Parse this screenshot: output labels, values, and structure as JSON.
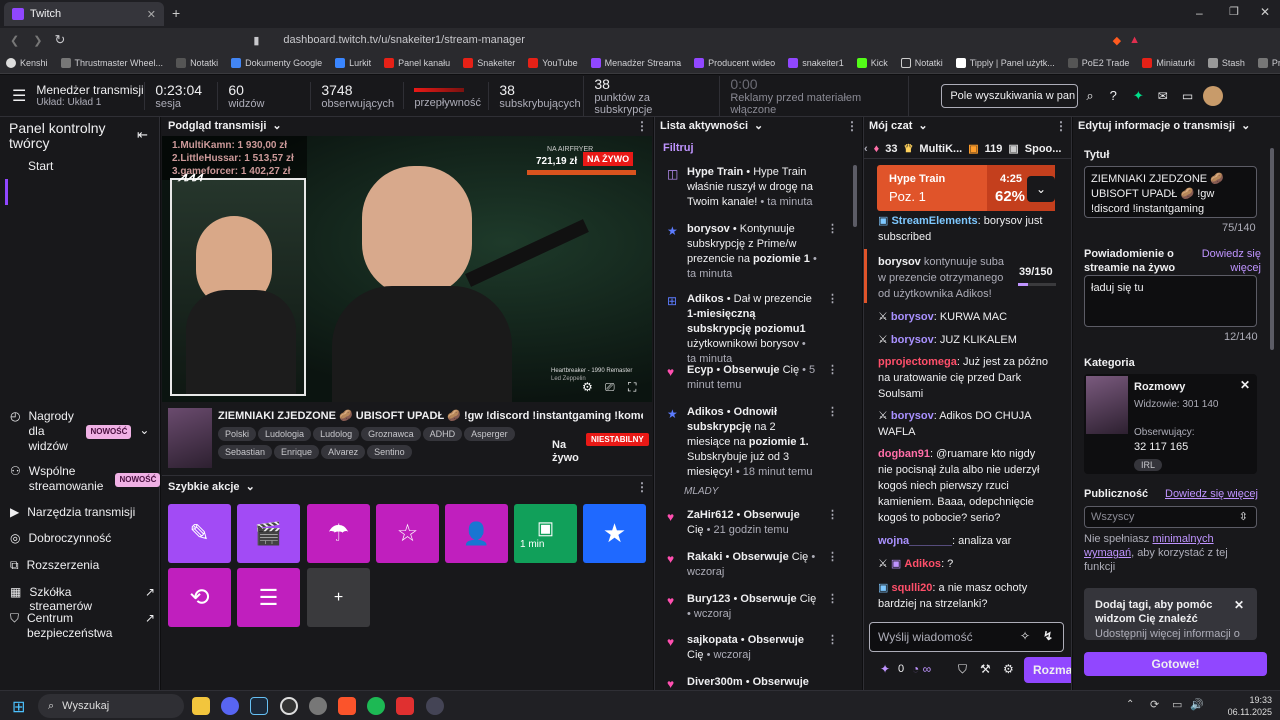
{
  "browser": {
    "tab_title": "Twitch",
    "url": "dashboard.twitch.tv/u/snakeiter1/stream-manager",
    "bookmarks": [
      "Kenshi",
      "Thrustmaster Wheel...",
      "Notatki",
      "Dokumenty Google",
      "Lurkit",
      "Panel kanału",
      "Snakeiter",
      "YouTube",
      "Menadżer Streama",
      "Producent wideo",
      "snakeiter1",
      "Kick",
      "Notatki",
      "Tipply | Panel użytk...",
      "PoE2 Trade",
      "Miniaturki",
      "Stash",
      "Przeczytaj - Kurs log..."
    ]
  },
  "header": {
    "title": "Menedżer transmisji",
    "layout": "Układ: Układ 1",
    "stats": [
      {
        "value": "0:23:04",
        "label": "sesja"
      },
      {
        "value": "60",
        "label": "widzów"
      },
      {
        "value": "3748",
        "label": "obserwujących"
      },
      {
        "value": "",
        "label": "przepływność"
      },
      {
        "value": "38",
        "label": "subskrybujących"
      },
      {
        "value": "38",
        "label": "punktów za subskrypcje"
      },
      {
        "value": "0:00",
        "label": "Reklamy przed materiałem włączone"
      }
    ],
    "search_placeholder": "Pole wyszukiwania w pan"
  },
  "leftnav": {
    "title": "Panel kontrolny twórcy",
    "items": [
      {
        "label": "Start"
      },
      {
        "label": "Nagrody dla widzów",
        "badge": "NOWOŚĆ"
      },
      {
        "label": "Wspólne streamowanie",
        "badge": "NOWOŚĆ"
      },
      {
        "label": "Narzędzia transmisji"
      },
      {
        "label": "Dobroczynność"
      },
      {
        "label": "Rozszerzenia"
      },
      {
        "label": "Szkółka streamerów"
      },
      {
        "label": "Centrum bezpieczeństwa"
      }
    ]
  },
  "preview": {
    "title": "Podgląd transmisji",
    "leaderboard": [
      "1.MultiKamn: 1 930,00 zł",
      "2.LittleHussar: 1 513,57 zł",
      "3.gameforcer: 1 402,27 zł"
    ],
    "overlay_amount": "721,19 zł",
    "live_badge": "NA ŻYWO",
    "airfryer": "NA AIRFRYER",
    "song": "Heartbreaker - 1990 Remaster",
    "artist": "Led Zeppelin",
    "stream_title": "ZIEMNIAKI ZJEDZONE 🥔 UBISOFT UPADŁ 🥔 !gw !discord !instantgaming !komendy",
    "tags": [
      "Polski",
      "Ludologia",
      "Ludolog",
      "Groznawca",
      "ADHD",
      "Asperger",
      "Sebastian",
      "Enrique",
      "Alvarez",
      "Sentino"
    ],
    "status": "Na żywo",
    "unstable": "NIESTABILNY"
  },
  "quick_actions": {
    "title": "Szybkie akcje",
    "ad_label": "1 min",
    "add": "+"
  },
  "activity": {
    "title": "Lista aktywności",
    "filter": "Filtruj",
    "items": [
      {
        "user": "Hype Train",
        "text": " • Hype Train właśnie ruszył w drogę na Twoim kanale!",
        "time": " • ta minuta"
      },
      {
        "user": "borysov",
        "text": " • Kontynuuje subskrypcję z Prime/w prezencie na ",
        "bold2": "poziomie 1",
        "time": " • ta minuta"
      },
      {
        "user": "Adikos",
        "text": " • Dał w prezencie ",
        "bold2": "1-miesięczną subskrypcję poziomu1",
        "text2": " użytkownikowi borysov",
        "time": " • ta minuta"
      },
      {
        "user": "Ecyp",
        "text": " • ",
        "bold2": "Obserwuje",
        "text2": " Cię",
        "time": " • 5 minut temu"
      },
      {
        "user": "Adikos",
        "text": " • ",
        "bold2": "Odnowił subskrypcję",
        "text2": " na 2 miesiące na ",
        "bold3": "poziomie 1.",
        "text3": " Subskrybuje już od 3 miesięcy!",
        "time": " • 18 minut temu",
        "msg": "MLADY"
      },
      {
        "user": "ZaHir612",
        "text": " • ",
        "bold2": "Obserwuje",
        "text2": " Cię",
        "time": " • 21 godzin temu"
      },
      {
        "user": "Rakaki",
        "text": " • ",
        "bold2": "Obserwuje",
        "text2": " Cię",
        "time": " • wczoraj"
      },
      {
        "user": "Bury123",
        "text": " • ",
        "bold2": "Obserwuje",
        "text2": " Cię",
        "time": " • wczoraj"
      },
      {
        "user": "sajkopata",
        "text": " • ",
        "bold2": "Obserwuje",
        "text2": " Cię",
        "time": " • wczoraj"
      },
      {
        "user": "Diver300m",
        "text": " • ",
        "bold2": "Obserwuje",
        "text2": "",
        "time": ""
      }
    ]
  },
  "chat": {
    "title": "Mój czat",
    "top_bar": [
      "33",
      "MultiK...",
      "119",
      "Spoo..."
    ],
    "hype_train": {
      "label": "Hype Train",
      "level": "Poz. 1",
      "timer": "4:25",
      "percent": "62%"
    },
    "sub_progress": "39/150",
    "messages": [
      {
        "user": "StreamElements",
        "user_color": "#7ec8ff",
        "text": ": borysov just subscribed"
      },
      {
        "user": "borysov",
        "user_color": "#efeff1",
        "text": " kontynuuje suba w prezencie otrzymanego od użytkownika Adikos!"
      },
      {
        "user": "borysov",
        "user_color": "#a991ff",
        "text": ": KURWA MAC"
      },
      {
        "user": "borysov",
        "user_color": "#a991ff",
        "text": ": JUZ KLIKALEM"
      },
      {
        "user": "pprojectomega",
        "user_color": "#ff4f6a",
        "text": ": Już jest za późno na uratowanie cię przed Dark Soulsami"
      },
      {
        "user": "borysov",
        "user_color": "#a991ff",
        "text": ": Adikos DO CHUJA WAFLA"
      },
      {
        "user": "dogban91",
        "user_color": "#ff6fa8",
        "text": ": @ruamare kto nigdy nie pocisnął żula albo nie uderzył kogoś niech pierwszy rzuci kamieniem. Baaa, odepchnięcie kogoś to pobocie? serio?"
      },
      {
        "user": "wojna_______",
        "user_color": "#a991ff",
        "text": ": analiza var"
      },
      {
        "user": "Adikos",
        "user_color": "#ff4f6a",
        "text": ": ?"
      },
      {
        "user": "squlli20",
        "user_color": "#ff4f6a",
        "text": ": a nie masz ochoty bardziej na strzelanki?"
      }
    ],
    "input_placeholder": "Wyślij wiadomość",
    "points": "0",
    "chat_button": "Rozmaw"
  },
  "edit": {
    "title": "Edytuj informacje o transmisji",
    "title_label": "Tytuł",
    "title_value": "ZIEMNIAKI ZJEDZONE 🥔 UBISOFT UPADŁ 🥔 !gw !discord !instantgaming",
    "title_count": "75/140",
    "notify_label": "Powiadomienie o streamie na żywo",
    "learn_more": "Dowiedz się więcej",
    "notify_value": "ładuj się tu",
    "notify_count": "12/140",
    "category_label": "Kategoria",
    "category_name": "Rozmowy",
    "viewers_label": "Widzowie: 301 140",
    "followers_label": "Obserwujący:",
    "followers_value": "32 117 165",
    "category_tag": "IRL",
    "audience_label": "Publiczność",
    "audience_learn": "Dowiedz się więcej",
    "audience_value": "Wszyscy",
    "req_text": "Nie spełniasz ",
    "req_link": "minimalnych wymagań",
    "req_text2": ", aby korzystać z tej funkcji",
    "tip_title": "Dodaj tagi, aby pomóc widzom Cię znaleźć",
    "tip_text": "Udostępnij więcej informacji o",
    "done_button": "Gotowe!"
  },
  "taskbar": {
    "search": "Wyszukaj",
    "time": "19:33",
    "date": "06.11.2025"
  }
}
